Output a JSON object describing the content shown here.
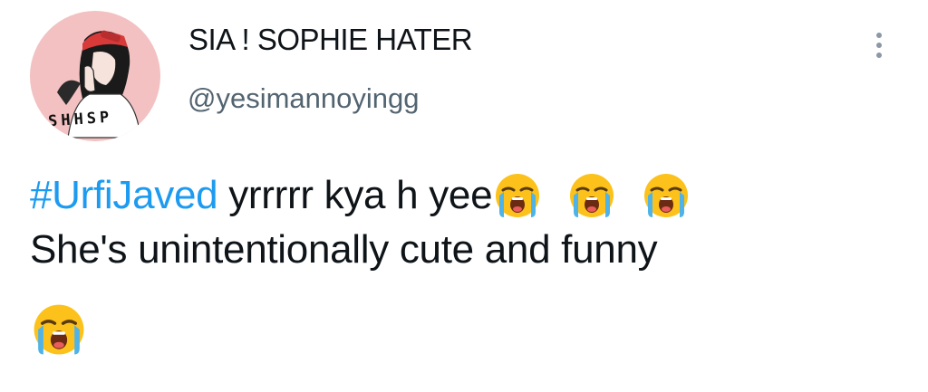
{
  "user": {
    "display_name": "SIA ! SOPHIE HATER",
    "handle": "@yesimannoyingg",
    "avatar_lettering": "SHHSP"
  },
  "tweet": {
    "hashtag": "#UrfiJaved",
    "line1_text": " yrrrrr kya h yee",
    "line2_text": "She's unintentionally cute and funny",
    "emoji": "loudly-crying-face-icon"
  },
  "colors": {
    "hashtag": "#1d9bf0",
    "text": "#0f1419",
    "handle": "#536471",
    "avatar_bg": "#f3c1c1"
  }
}
